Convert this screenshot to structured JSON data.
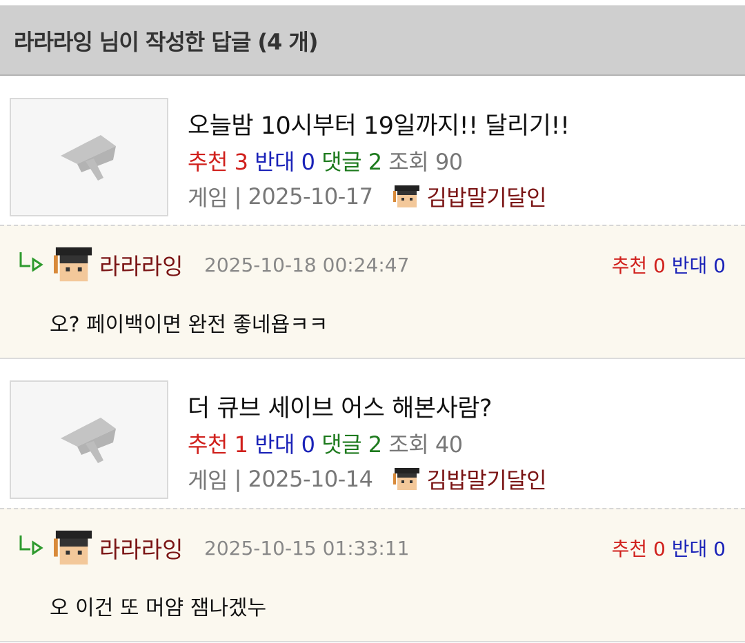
{
  "header": {
    "title": "라라라잉 님이 작성한 답글 (4 개)"
  },
  "items": [
    {
      "post": {
        "thumbnail_icon": "graduation-cap-icon",
        "title": "오늘밤 10시부터 19일까지!! 달리기!!",
        "stats": {
          "recommend_label": "추천",
          "recommend": "3",
          "oppose_label": "반대",
          "oppose": "0",
          "comment_label": "댓글",
          "comment": "2",
          "view_label": "조회",
          "view": "90"
        },
        "category": "게임",
        "separator": "|",
        "date": "2025-10-17",
        "author": "김밥말기달인"
      },
      "reply": {
        "nickname": "라라라잉",
        "time": "2025-10-18 00:24:47",
        "recommend_label": "추천",
        "recommend": "0",
        "oppose_label": "반대",
        "oppose": "0",
        "text": "오? 페이백이면 완전 좋네욥ㅋㅋ"
      }
    },
    {
      "post": {
        "thumbnail_icon": "graduation-cap-icon",
        "title": "더 큐브 세이브 어스 해본사람?",
        "stats": {
          "recommend_label": "추천",
          "recommend": "1",
          "oppose_label": "반대",
          "oppose": "0",
          "comment_label": "댓글",
          "comment": "2",
          "view_label": "조회",
          "view": "40"
        },
        "category": "게임",
        "separator": "|",
        "date": "2025-10-14",
        "author": "김밥말기달인"
      },
      "reply": {
        "nickname": "라라라잉",
        "time": "2025-10-15 01:33:11",
        "recommend_label": "추천",
        "recommend": "0",
        "oppose_label": "반대",
        "oppose": "0",
        "text": "오 이건 또 머얌 잼나겠누"
      }
    }
  ],
  "colors": {
    "header_bg": "#cfcfcf",
    "reply_bg": "#fbf8ef",
    "recommend": "#d0201c",
    "oppose": "#1a22b8",
    "comment": "#1d7a1d",
    "nickname": "#7a1414",
    "reply_arrow": "#2e9a2e"
  }
}
